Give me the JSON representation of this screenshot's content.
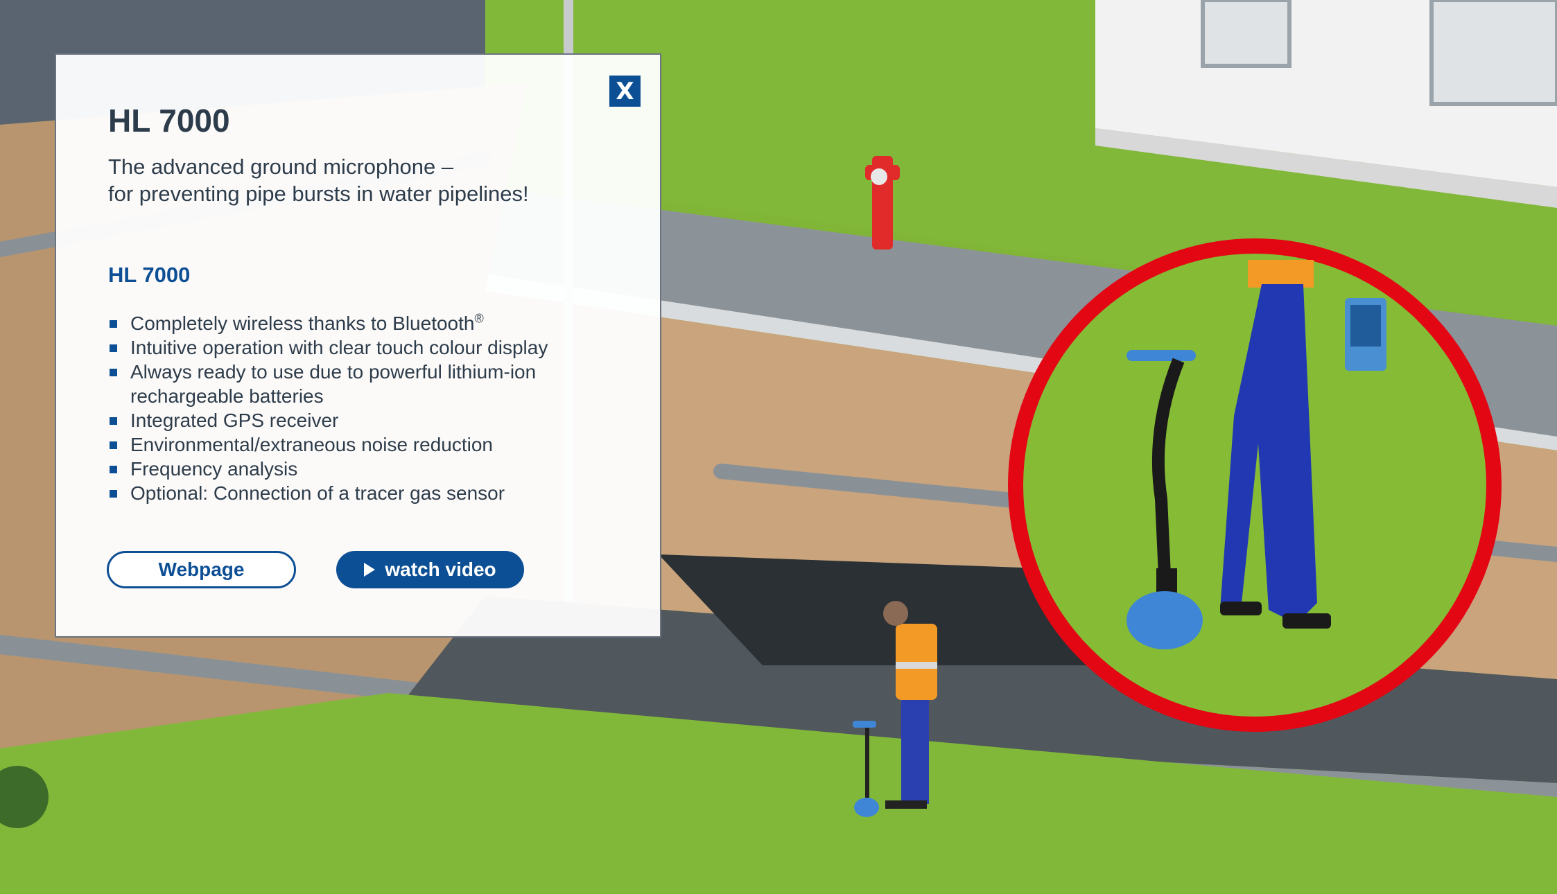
{
  "panel": {
    "close_label": "X",
    "title": "HL 7000",
    "subtitle_line1": "The advanced ground microphone –",
    "subtitle_line2": "for preventing pipe bursts in water pipelines!",
    "section_title": "HL 7000",
    "features": [
      "Completely wireless thanks to Bluetooth",
      "Intuitive operation with clear touch colour display",
      "Always ready to use due to powerful lithium-ion rechargeable batteries",
      "Integrated GPS receiver",
      "Environmental/extraneous noise reduction",
      "Frequency analysis",
      "Optional: Connection of a tracer gas sensor"
    ],
    "registered_mark": "®",
    "webpage_label": "Webpage",
    "video_label": "watch video"
  },
  "colors": {
    "brand_blue": "#0d4f95",
    "text_dark": "#2d3c4b",
    "highlight_red": "#e30613",
    "grass": "#7fb33a"
  },
  "icons": [
    "close-icon",
    "play-icon",
    "bullet-icon"
  ]
}
